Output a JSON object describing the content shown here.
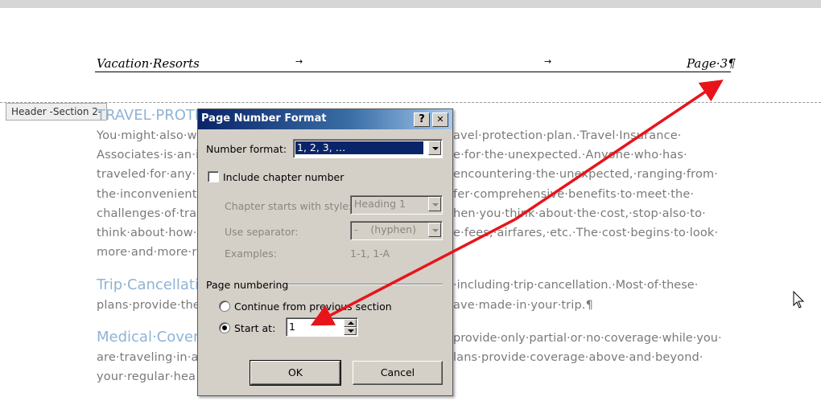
{
  "header": {
    "left": "Vacation·Resorts",
    "right": "Page·3¶",
    "tab_glyph": "→",
    "section_tag": "Header -Section 2-"
  },
  "document": {
    "heading1": "TRAVEL·PROTE",
    "para1": [
      {
        "left": "You·might·also·w",
        "right": "avel·protection·plan.·Travel·Insurance·"
      },
      {
        "left": "Associates·is·an·i",
        "right": "e·for·the·unexpected.·Anyone·who·has·"
      },
      {
        "left": "traveled·for·any·",
        "right": "encountering·the·unexpected,·ranging·from·"
      },
      {
        "left": "the·inconvenient",
        "right": "fer·comprehensive·benefits·to·meet·the·"
      },
      {
        "left": "challenges·of·tra",
        "right": "hen·you·think·about·the·cost,·stop·also·to·"
      },
      {
        "left": "think·about·how·",
        "right": "e·fees,·airfares,·etc.·The·cost·begins·to·look·"
      },
      {
        "left": "more·and·more·r",
        "right": ""
      }
    ],
    "heading2": {
      "left": "Trip·Cancellati",
      "right": "·including·trip·cancellation.·Most·of·these·"
    },
    "para2": {
      "left": "plans·provide·the",
      "right": "ave·made·in·your·trip.¶"
    },
    "heading3": {
      "left": "Medical·Cover",
      "right": "provide·only·partial·or·no·coverage·while·you·"
    },
    "para3": [
      {
        "left": "are·traveling·in·a",
        "right": "lans·provide·coverage·above·and·beyond·"
      },
      {
        "left": "your·regular·hea",
        "right": ""
      }
    ]
  },
  "dialog": {
    "title": "Page Number Format",
    "help_glyph": "?",
    "close_glyph": "✕",
    "number_format_label": "Number format:",
    "number_format_value": "1, 2, 3, …",
    "include_chapter_label": "Include chapter number",
    "chapter_style_label": "Chapter starts with style:",
    "chapter_style_value": "Heading 1",
    "separator_label": "Use separator:",
    "separator_value": "-    (hyphen)",
    "examples_label": "Examples:",
    "examples_value": "1-1, 1-A",
    "page_numbering_label": "Page numbering",
    "continue_label": "Continue from previous section",
    "start_at_label": "Start at:",
    "start_at_value": "1",
    "ok_label": "OK",
    "cancel_label": "Cancel"
  },
  "colors": {
    "annotation_arrow": "#e8141a",
    "heading_blue": "#8fb3d6",
    "title_bar": "#0a246a"
  }
}
